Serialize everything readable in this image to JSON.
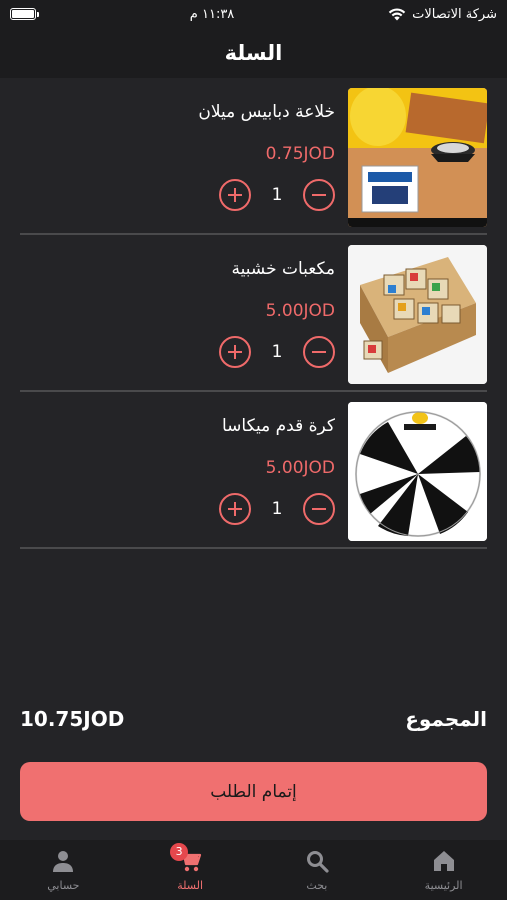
{
  "status_bar": {
    "carrier": "شركة الاتصالات",
    "time": "١١:٣٨ م"
  },
  "header": {
    "title": "السلة"
  },
  "cart": {
    "items": [
      {
        "name": "خلاعة دبابيس ميلان",
        "price": "0.75JOD",
        "quantity": "1",
        "image": "staple-remover-photo"
      },
      {
        "name": "مكعبات خشبية",
        "price": "5.00JOD",
        "quantity": "1",
        "image": "wooden-blocks-photo"
      },
      {
        "name": "كرة قدم ميكاسا",
        "price": "5.00JOD",
        "quantity": "1",
        "image": "soccer-ball-photo"
      }
    ]
  },
  "total": {
    "label": "المجموع",
    "value": "10.75JOD"
  },
  "checkout": {
    "label": "إتمام الطلب"
  },
  "tab_bar": {
    "tabs": [
      {
        "label": "حسابي",
        "icon": "person-icon"
      },
      {
        "label": "السلة",
        "icon": "cart-icon",
        "badge": "3",
        "active": true
      },
      {
        "label": "بحث",
        "icon": "search-icon"
      },
      {
        "label": "الرئيسية",
        "icon": "home-icon"
      }
    ]
  },
  "colors": {
    "accent": "#f07070",
    "background": "#242427",
    "bar": "#1c1c1e"
  }
}
